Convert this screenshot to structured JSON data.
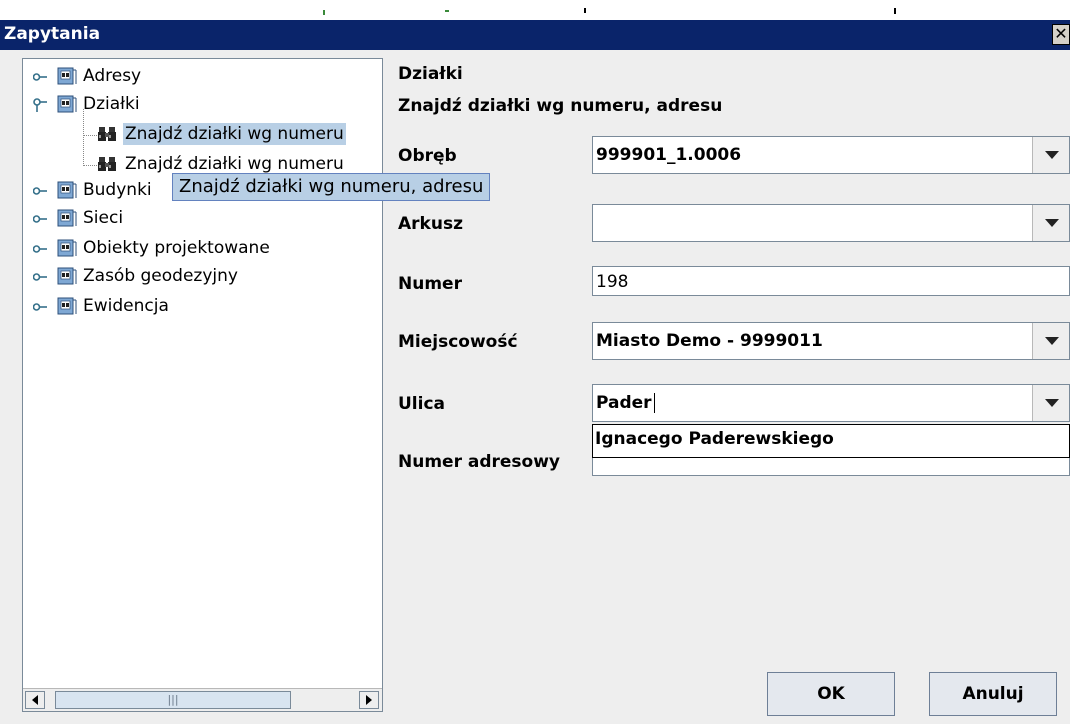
{
  "window": {
    "title": "Zapytania",
    "close_glyph": "✕"
  },
  "tree": {
    "nodes": [
      {
        "label": "Adresy"
      },
      {
        "label": "Działki"
      },
      {
        "label": "Znajdź działki wg numeru"
      },
      {
        "label": "Znajdź działki wg numeru"
      },
      {
        "label": "Budynki"
      },
      {
        "label": "Sieci"
      },
      {
        "label": "Obiekty projektowane"
      },
      {
        "label": "Zasób geodezyjny"
      },
      {
        "label": "Ewidencja"
      }
    ],
    "tooltip": "Znajdź działki wg numeru, adresu"
  },
  "form": {
    "heading": "Działki",
    "subheading": "Znajdź działki wg numeru, adresu",
    "obreb": {
      "label": "Obręb",
      "value": "999901_1.0006"
    },
    "arkusz": {
      "label": "Arkusz",
      "value": ""
    },
    "numer": {
      "label": "Numer",
      "value": "198"
    },
    "miejscowosc": {
      "label": "Miejscowość",
      "value": "Miasto Demo - 9999011"
    },
    "ulica": {
      "label": "Ulica",
      "value": "Pader"
    },
    "numer_adresowy": {
      "label": "Numer adresowy",
      "value": ""
    },
    "ulica_suggestion": "Ignacego Paderewskiego"
  },
  "buttons": {
    "ok": "OK",
    "cancel": "Anuluj"
  },
  "colors": {
    "titlebar": "#0a246a",
    "selection": "#b8cfe5",
    "panel": "#eeeeee"
  }
}
